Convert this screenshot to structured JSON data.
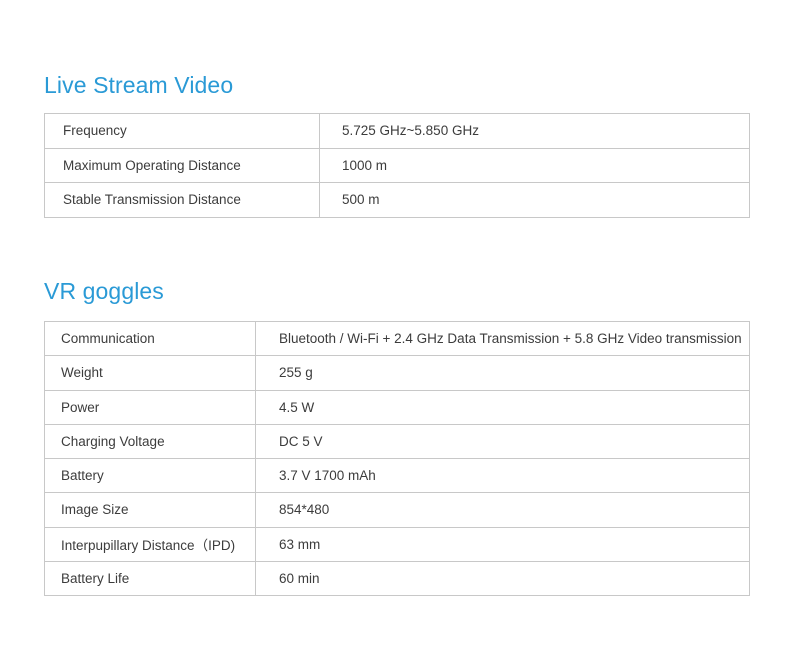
{
  "live_stream": {
    "title": "Live Stream Video",
    "rows": [
      {
        "label": "Frequency",
        "value": "5.725 GHz~5.850 GHz"
      },
      {
        "label": "Maximum Operating Distance",
        "value": "1000 m"
      },
      {
        "label": "Stable Transmission Distance",
        "value": "500 m"
      }
    ]
  },
  "vr_goggles": {
    "title": "VR goggles",
    "rows": [
      {
        "label": "Communication",
        "value": "Bluetooth / Wi-Fi + 2.4 GHz Data Transmission + 5.8 GHz Video transmission"
      },
      {
        "label": "Weight",
        "value": "255 g"
      },
      {
        "label": "Power",
        "value": "4.5 W"
      },
      {
        "label": "Charging Voltage",
        "value": "DC 5 V"
      },
      {
        "label": "Battery",
        "value": "3.7 V 1700 mAh"
      },
      {
        "label": "Image Size",
        "value": "854*480"
      },
      {
        "label": "Interpupillary Distance（IPD)",
        "value": "63 mm"
      },
      {
        "label": "Battery Life",
        "value": "60 min"
      }
    ]
  },
  "colors": {
    "heading": "#2a9ad6",
    "border": "#c8c8c8",
    "text": "#3c3c3c"
  }
}
